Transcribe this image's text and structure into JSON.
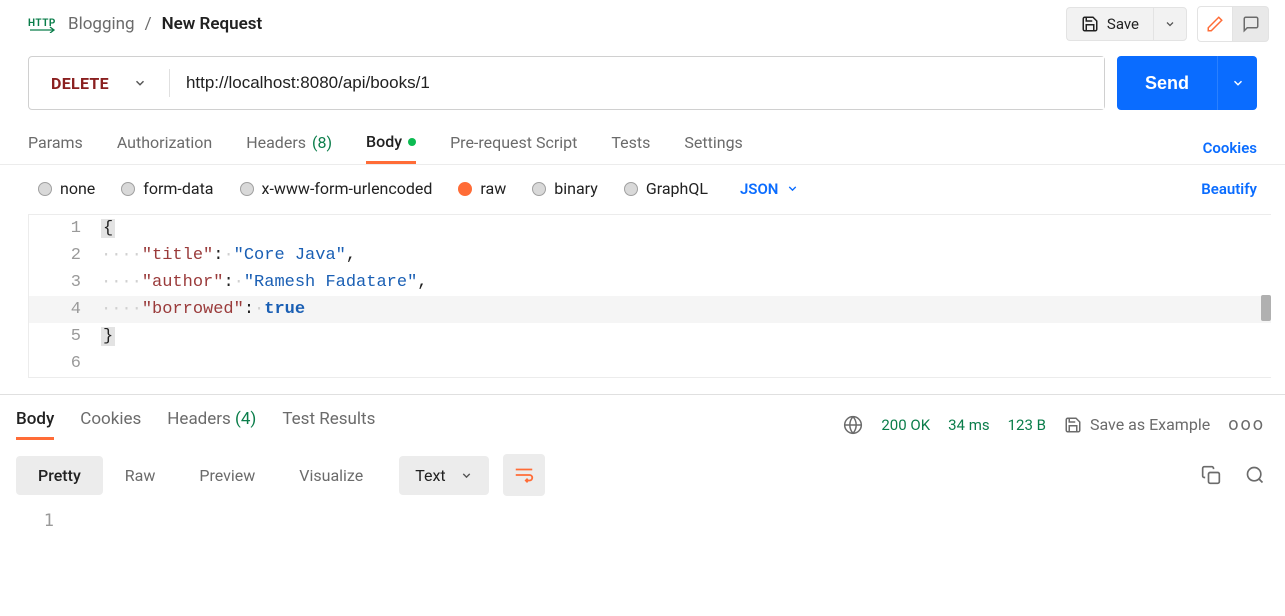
{
  "breadcrumb": {
    "collection": "Blogging",
    "request": "New Request"
  },
  "topbar": {
    "save": "Save"
  },
  "request": {
    "method": "DELETE",
    "url": "http://localhost:8080/api/books/1",
    "send": "Send"
  },
  "tabs": {
    "params": "Params",
    "authorization": "Authorization",
    "headers": "Headers",
    "headers_count": "(8)",
    "body": "Body",
    "prerequest": "Pre-request Script",
    "tests": "Tests",
    "settings": "Settings",
    "cookies": "Cookies"
  },
  "body_types": {
    "none": "none",
    "form_data": "form-data",
    "urlencoded": "x-www-form-urlencoded",
    "raw": "raw",
    "binary": "binary",
    "graphql": "GraphQL",
    "format": "JSON",
    "beautify": "Beautify"
  },
  "editor": {
    "l1": "{",
    "l2_key": "\"title\"",
    "l2_val": "\"Core Java\"",
    "l3_key": "\"author\"",
    "l3_val": "\"Ramesh Fadatare\"",
    "l4_key": "\"borrowed\"",
    "l4_val": "true",
    "l5": "}"
  },
  "response_tabs": {
    "body": "Body",
    "cookies": "Cookies",
    "headers": "Headers",
    "headers_count": "(4)",
    "test_results": "Test Results"
  },
  "response_status": {
    "code": "200 OK",
    "time": "34 ms",
    "size": "123 B",
    "save_example": "Save as Example"
  },
  "response_view": {
    "pretty": "Pretty",
    "raw": "Raw",
    "preview": "Preview",
    "visualize": "Visualize",
    "format": "Text"
  }
}
